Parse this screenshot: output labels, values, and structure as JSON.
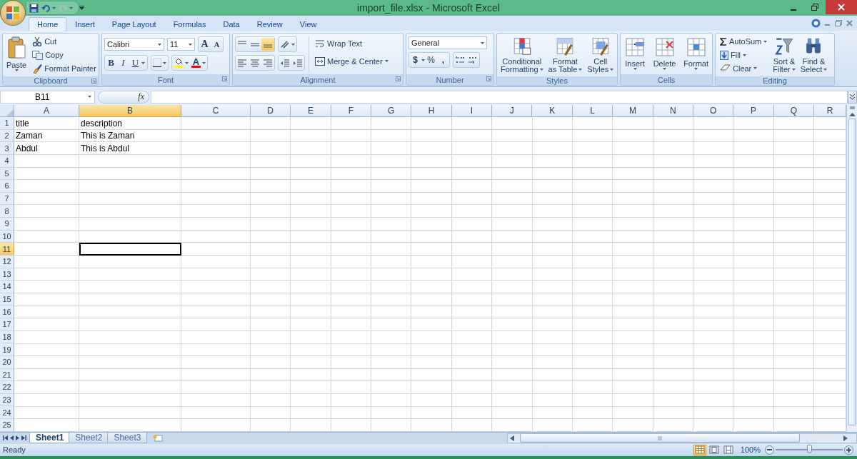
{
  "window": {
    "title": "import_file.xlsx - Microsoft Excel"
  },
  "tabs": [
    {
      "label": "Home",
      "selected": true
    },
    {
      "label": "Insert",
      "selected": false
    },
    {
      "label": "Page Layout",
      "selected": false
    },
    {
      "label": "Formulas",
      "selected": false
    },
    {
      "label": "Data",
      "selected": false
    },
    {
      "label": "Review",
      "selected": false
    },
    {
      "label": "View",
      "selected": false
    }
  ],
  "clipboard": {
    "title": "Clipboard",
    "paste": "Paste",
    "cut": "Cut",
    "copy": "Copy",
    "format_painter": "Format Painter"
  },
  "font": {
    "title": "Font",
    "font_name": "Calibri",
    "font_size": "11",
    "grow_font": "A",
    "shrink_font": "A",
    "bold": "B",
    "italic": "I",
    "underline": "U",
    "font_color": "A"
  },
  "alignment": {
    "title": "Alignment",
    "wrap_text": "Wrap Text",
    "merge_center": "Merge & Center"
  },
  "number": {
    "title": "Number",
    "format": "General",
    "currency": "$",
    "percent": "%",
    "comma": ","
  },
  "styles": {
    "title": "Styles",
    "buttons": [
      {
        "lines": [
          "Conditional",
          "Formatting"
        ]
      },
      {
        "lines": [
          "Format",
          "as Table"
        ]
      },
      {
        "lines": [
          "Cell",
          "Styles"
        ]
      }
    ]
  },
  "cells": {
    "title": "Cells",
    "buttons": [
      "Insert",
      "Delete",
      "Format"
    ]
  },
  "editing": {
    "title": "Editing",
    "autosum": "AutoSum",
    "fill": "Fill",
    "clear": "Clear",
    "sort": [
      "Sort &",
      "Filter"
    ],
    "find": [
      "Find &",
      "Select"
    ]
  },
  "formula_bar": {
    "name_box": "B11",
    "function_label": "fx"
  },
  "grid": {
    "columns": [
      {
        "label": "A",
        "selected": false
      },
      {
        "label": "B",
        "selected": true
      },
      {
        "label": "C",
        "selected": false
      },
      {
        "label": "D",
        "selected": false
      },
      {
        "label": "E",
        "selected": false
      },
      {
        "label": "F",
        "selected": false
      },
      {
        "label": "G",
        "selected": false
      },
      {
        "label": "H",
        "selected": false
      },
      {
        "label": "I",
        "selected": false
      },
      {
        "label": "J",
        "selected": false
      },
      {
        "label": "K",
        "selected": false
      },
      {
        "label": "L",
        "selected": false
      },
      {
        "label": "M",
        "selected": false
      },
      {
        "label": "N",
        "selected": false
      },
      {
        "label": "O",
        "selected": false
      },
      {
        "label": "P",
        "selected": false
      },
      {
        "label": "Q",
        "selected": false
      },
      {
        "label": "R",
        "selected": false
      }
    ],
    "rows": [
      {
        "label": "1",
        "selected": false,
        "cells": [
          "title",
          "description"
        ]
      },
      {
        "label": "2",
        "selected": false,
        "cells": [
          "Zaman",
          "This is Zaman"
        ]
      },
      {
        "label": "3",
        "selected": false,
        "cells": [
          "Abdul",
          "This is Abdul"
        ]
      },
      {
        "label": "4",
        "selected": false
      },
      {
        "label": "5",
        "selected": false
      },
      {
        "label": "6",
        "selected": false
      },
      {
        "label": "7",
        "selected": false
      },
      {
        "label": "8",
        "selected": false
      },
      {
        "label": "9",
        "selected": false
      },
      {
        "label": "10",
        "selected": false
      },
      {
        "label": "11",
        "selected": true
      },
      {
        "label": "12",
        "selected": false
      },
      {
        "label": "13",
        "selected": false
      },
      {
        "label": "14",
        "selected": false
      },
      {
        "label": "15",
        "selected": false
      },
      {
        "label": "16",
        "selected": false
      },
      {
        "label": "17",
        "selected": false
      },
      {
        "label": "18",
        "selected": false
      },
      {
        "label": "19",
        "selected": false
      },
      {
        "label": "20",
        "selected": false
      },
      {
        "label": "21",
        "selected": false
      },
      {
        "label": "22",
        "selected": false
      },
      {
        "label": "23",
        "selected": false
      },
      {
        "label": "24",
        "selected": false
      },
      {
        "label": "25",
        "selected": false
      }
    ]
  },
  "sheet_tabs": [
    {
      "label": "Sheet1",
      "selected": true
    },
    {
      "label": "Sheet2",
      "selected": false
    },
    {
      "label": "Sheet3",
      "selected": false
    }
  ],
  "status_bar": {
    "text": "Ready",
    "views": [
      {
        "kind": "normal",
        "selected": true
      },
      {
        "kind": "page_layout",
        "selected": false
      },
      {
        "kind": "page_break",
        "selected": false
      }
    ],
    "zoom": "100%",
    "zoom_slider": {
      "level": 0.5
    }
  }
}
